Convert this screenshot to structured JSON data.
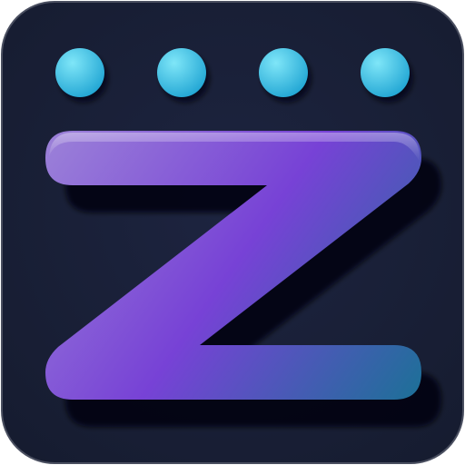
{
  "icon": {
    "glyph": "Z",
    "dot_count": 4,
    "colors": {
      "background": "#161c30",
      "border": "#4a4f60",
      "dot_light": "#7fe6f8",
      "dot_dark": "#22a6d4",
      "glyph_top_left": "#9a7fd8",
      "glyph_mid": "#7742d6",
      "glyph_bottom_right": "#1f6f99",
      "shadow": "#05070d"
    }
  }
}
